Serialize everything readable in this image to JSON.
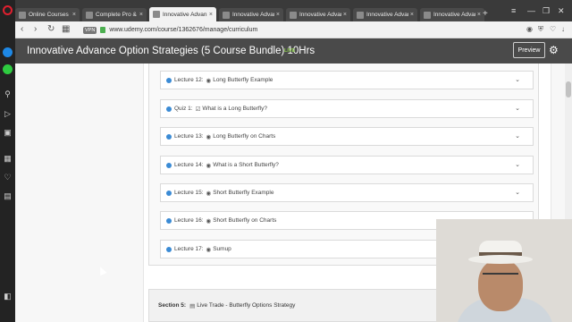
{
  "browser": {
    "tabs": [
      {
        "label": "Online Courses - A"
      },
      {
        "label": "Complete Pro & A"
      },
      {
        "label": "Innovative Advan"
      },
      {
        "label": "Innovative Advan"
      },
      {
        "label": "Innovative Advan"
      },
      {
        "label": "Innovative Advan"
      },
      {
        "label": "Innovative Advan"
      }
    ],
    "address": {
      "vpn": "VPN",
      "url": "www.udemy.com/course/1362676/manage/curriculum"
    }
  },
  "header": {
    "course_title": "Innovative Advance Option Strategies (5 Course Bundle) 10Hrs",
    "status_badge": "LIVE",
    "preview_label": "Preview"
  },
  "curriculum": {
    "items": [
      {
        "kind": "Lecture 12:",
        "icon": "play-circle-icon",
        "title": "Long Butterfly Example"
      },
      {
        "kind": "Quiz 1:",
        "icon": "checkbox-icon",
        "title": "What is a Long Butterfly?"
      },
      {
        "kind": "Lecture 13:",
        "icon": "play-circle-icon",
        "title": "Long Butterfly on Charts"
      },
      {
        "kind": "Lecture 14:",
        "icon": "play-circle-icon",
        "title": "What is a Short Butterfly?"
      },
      {
        "kind": "Lecture 15:",
        "icon": "play-circle-icon",
        "title": "Short Butterfly Example"
      },
      {
        "kind": "Lecture 16:",
        "icon": "play-circle-icon",
        "title": "Short Butterfly on Charts"
      },
      {
        "kind": "Lecture 17:",
        "icon": "play-circle-icon",
        "title": "Sumup"
      }
    ],
    "next_section": {
      "label": "Section 5:",
      "icon": "document-icon",
      "title": "Live Trade - Butterfly Options Strategy"
    }
  },
  "colors": {
    "header_bg": "#4a4a4a",
    "live_badge": "#8fd14f",
    "check_blue": "#3b8bd5"
  }
}
